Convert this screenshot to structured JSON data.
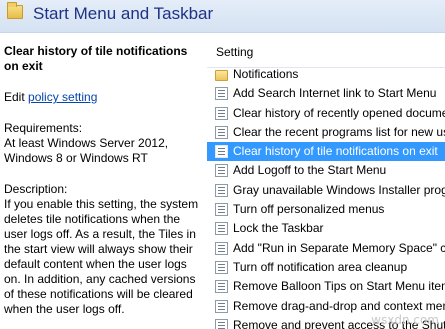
{
  "header": {
    "title": "Start Menu and Taskbar",
    "icon": "folder-icon"
  },
  "description_pane": {
    "title": "Clear history of tile notifications on exit",
    "edit_prefix": "Edit ",
    "edit_link": "policy setting",
    "requirements": "Requirements:\nAt least Windows Server 2012, Windows 8 or Windows RT",
    "description": "Description:\nIf you enable this setting, the system deletes tile notifications when the user logs off. As a result, the Tiles in the start view will always show their default content when the user logs on. In addition, any cached versions of these notifications will be cleared when the user logs off."
  },
  "settings": {
    "column_header": "Setting",
    "items": [
      {
        "label": "Notifications",
        "icon": "folder-icon",
        "selected": false
      },
      {
        "label": "Add Search Internet link to Start Menu",
        "icon": "setting-icon",
        "selected": false
      },
      {
        "label": "Clear history of recently opened documents on exit",
        "icon": "setting-icon",
        "selected": false
      },
      {
        "label": "Clear the recent programs list for new users",
        "icon": "setting-icon",
        "selected": false
      },
      {
        "label": "Clear history of tile notifications on exit",
        "icon": "setting-icon",
        "selected": true
      },
      {
        "label": "Add Logoff to the Start Menu",
        "icon": "setting-icon",
        "selected": false
      },
      {
        "label": "Gray unavailable Windows Installer programs",
        "icon": "setting-icon",
        "selected": false
      },
      {
        "label": "Turn off personalized menus",
        "icon": "setting-icon",
        "selected": false
      },
      {
        "label": "Lock the Taskbar",
        "icon": "setting-icon",
        "selected": false
      },
      {
        "label": "Add \"Run in Separate Memory Space\" check box",
        "icon": "setting-icon",
        "selected": false
      },
      {
        "label": "Turn off notification area cleanup",
        "icon": "setting-icon",
        "selected": false
      },
      {
        "label": "Remove Balloon Tips on Start Menu items",
        "icon": "setting-icon",
        "selected": false
      },
      {
        "label": "Remove drag-and-drop and context menus",
        "icon": "setting-icon",
        "selected": false
      },
      {
        "label": "Remove and prevent access to the Shut Down",
        "icon": "setting-icon",
        "selected": false
      }
    ]
  },
  "watermark": "wsxdn.com",
  "colors": {
    "header_title": "#1e3287",
    "selection": "#3399ff",
    "link": "#0645ad"
  }
}
